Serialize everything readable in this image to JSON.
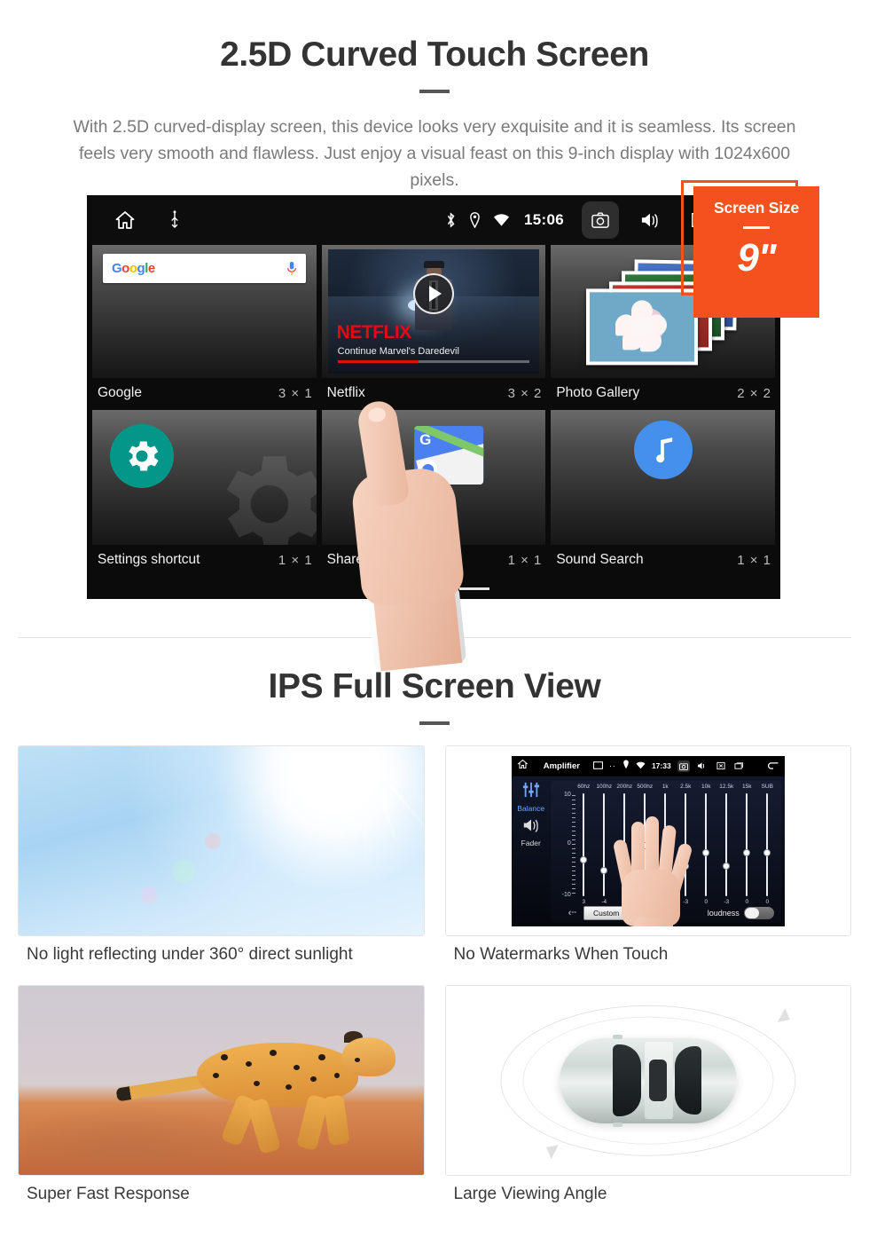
{
  "section1": {
    "title": "2.5D Curved Touch Screen",
    "description": "With 2.5D curved-display screen, this device looks very exquisite and it is seamless. Its screen feels very smooth and flawless. Just enjoy a visual feast on this 9-inch display with 1024x600 pixels."
  },
  "badge": {
    "title": "Screen Size",
    "value": "9\"",
    "color": "#f4511e"
  },
  "device": {
    "statusbar": {
      "clock": "15:06",
      "left_icons": [
        "home-icon",
        "usb-icon"
      ],
      "right_icons": [
        "bluetooth-icon",
        "location-icon",
        "wifi-icon"
      ],
      "buttons": [
        "screenshot-icon",
        "volume-icon",
        "close-icon",
        "recents-icon"
      ]
    },
    "widgets": [
      {
        "name": "Google",
        "size": "3 × 1",
        "icon": "google-search-widget",
        "search_placeholder": "Google",
        "logo_letters": [
          "G",
          "o",
          "o",
          "g",
          "l",
          "e"
        ]
      },
      {
        "name": "Netflix",
        "size": "3 × 2",
        "icon": "netflix-widget",
        "brand": "NETFLIX",
        "subtitle": "Continue Marvel's Daredevil"
      },
      {
        "name": "Photo Gallery",
        "size": "2 × 2",
        "icon": "photo-gallery-widget"
      },
      {
        "name": "Settings shortcut",
        "size": "1 × 1",
        "icon": "gear-icon"
      },
      {
        "name": "Share location",
        "size": "1 × 1",
        "icon": "google-maps-icon"
      },
      {
        "name": "Sound Search",
        "size": "1 × 1",
        "icon": "music-note-icon"
      }
    ],
    "page_indicator": {
      "count": 3,
      "active": 3
    }
  },
  "section2": {
    "title": "IPS Full Screen View",
    "cards": [
      {
        "caption": "No light reflecting under 360° direct sunlight",
        "image": "sunlight-photo"
      },
      {
        "caption": "No Watermarks When Touch",
        "image": "amplifier-screenshot"
      },
      {
        "caption": "Super Fast Response",
        "image": "cheetah-photo"
      },
      {
        "caption": "Large Viewing Angle",
        "image": "car-top-view-photo"
      }
    ]
  },
  "amplifier": {
    "title": "Amplifier",
    "clock": "17:33",
    "sidebar": [
      {
        "label": "Balance",
        "icon": "sliders-icon",
        "active": true
      },
      {
        "label": "Fader",
        "icon": "speaker-icon",
        "active": false
      }
    ],
    "scale": {
      "top": "10",
      "mid": "0",
      "bottom": "-10"
    },
    "bands": [
      "60hz",
      "100hz",
      "200hz",
      "500hz",
      "1k",
      "2.5k",
      "10k",
      "12.5k",
      "15k",
      "SUB"
    ],
    "values": [
      "3",
      "-4",
      "0",
      "0",
      "0",
      "-3",
      "0",
      "-3",
      "0",
      "0"
    ],
    "preset_button": "Custom",
    "loudness_label": "loudness",
    "back_icon": "back-arrow-icon"
  }
}
